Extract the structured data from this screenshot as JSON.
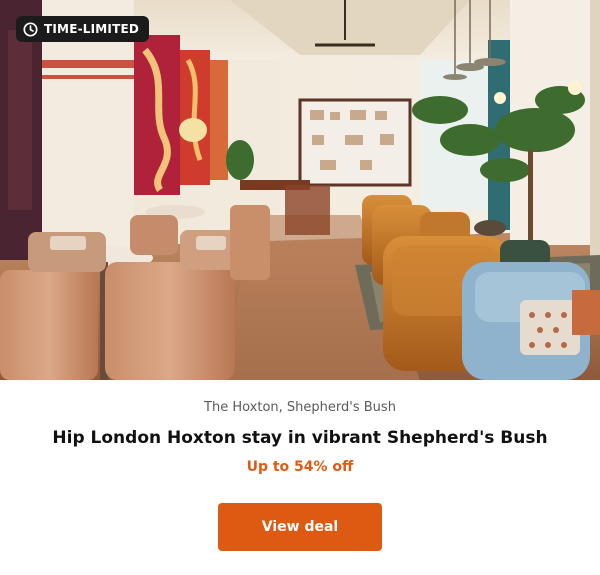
{
  "badge": {
    "label": "TIME-LIMITED",
    "icon": "clock-icon"
  },
  "hotel": {
    "location": "The Hoxton, Shepherd's Bush"
  },
  "deal": {
    "title": "Hip London Hoxton stay in vibrant Shepherd's Bush",
    "discount": "Up to 54% off",
    "button_label": "View deal"
  },
  "colors": {
    "accent": "#de5a12",
    "discount_text": "#e05a13",
    "badge_bg": "#1b1b1b"
  }
}
